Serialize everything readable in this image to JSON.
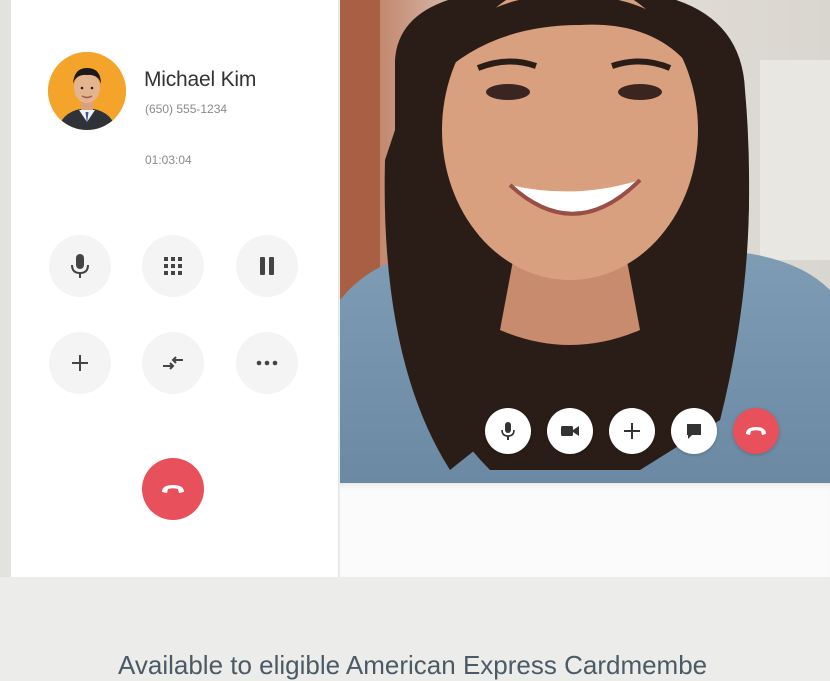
{
  "contact": {
    "name": "Michael Kim",
    "phone": "(650) 555-1234",
    "duration": "01:03:04"
  },
  "controls": {
    "row1": [
      "microphone-icon",
      "keypad-icon",
      "pause-icon"
    ],
    "row2": [
      "add-icon",
      "transfer-icon",
      "more-icon"
    ],
    "hangup": "hangup-icon"
  },
  "video_controls": [
    "microphone-icon",
    "video-camera-icon",
    "add-icon",
    "chat-icon",
    "hangup-icon"
  ],
  "colors": {
    "hangup_red": "#e8505b",
    "avatar_bg": "#f4a42b",
    "page_bg": "#ecedea",
    "footer_text": "#4b5a66"
  },
  "footer": {
    "text": "Available to eligible American Express Cardmembe"
  }
}
